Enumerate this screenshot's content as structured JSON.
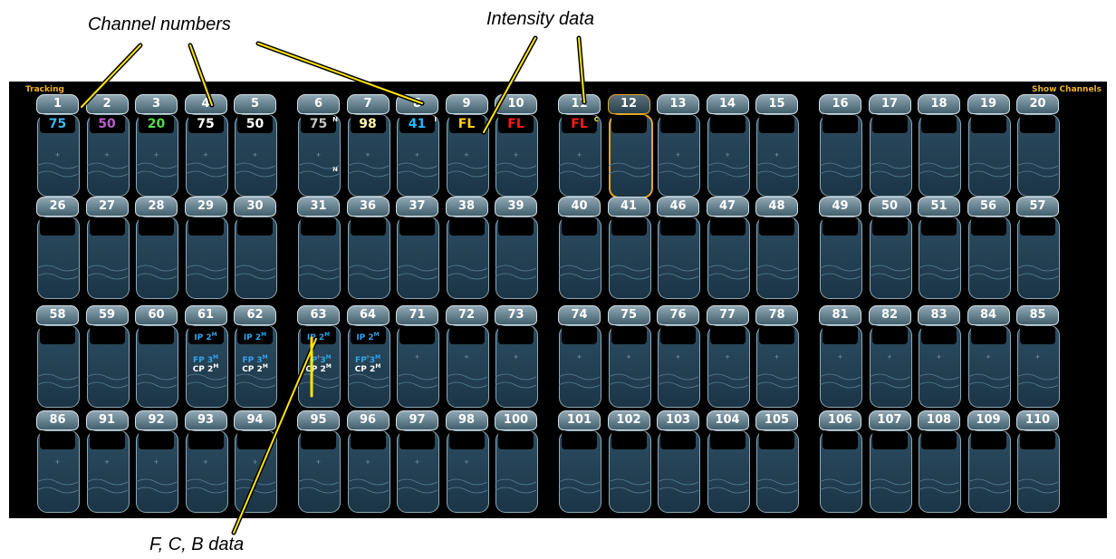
{
  "callouts": {
    "channel_numbers": "Channel numbers",
    "intensity_data": "Intensity data",
    "fcb_data": "F, C, B data"
  },
  "panel": {
    "left_label": "Tracking",
    "right_label": "Show Channels"
  },
  "channels": {
    "rows": [
      [
        {
          "n": "1",
          "int": "75",
          "icls": "c1"
        },
        {
          "n": "2",
          "int": "50",
          "icls": "c2"
        },
        {
          "n": "3",
          "int": "20",
          "icls": "c3"
        },
        {
          "n": "4",
          "int": "75",
          "icls": "c4"
        },
        {
          "n": "5",
          "int": "50",
          "icls": "c5"
        },
        {
          "n": "6",
          "int": "75",
          "icls": "c6",
          "flag": "N",
          "mark": "N"
        },
        {
          "n": "7",
          "int": "98",
          "icls": "c7"
        },
        {
          "n": "8",
          "int": "41",
          "icls": "c8",
          "flag": "I"
        },
        {
          "n": "9",
          "int": "FL",
          "icls": "c9"
        },
        {
          "n": "10",
          "int": "FL",
          "icls": "c10"
        },
        {
          "n": "11",
          "int": "FL",
          "icls": "c11",
          "flag": "C",
          "flagcls": "ycol"
        },
        {
          "n": "12",
          "sel": true
        },
        {
          "n": "13"
        },
        {
          "n": "14"
        },
        {
          "n": "15"
        },
        {
          "n": "16"
        },
        {
          "n": "17"
        },
        {
          "n": "18"
        },
        {
          "n": "19"
        },
        {
          "n": "20"
        }
      ],
      [
        {
          "n": "26"
        },
        {
          "n": "27"
        },
        {
          "n": "28"
        },
        {
          "n": "29"
        },
        {
          "n": "30"
        },
        {
          "n": "31"
        },
        {
          "n": "36"
        },
        {
          "n": "37"
        },
        {
          "n": "38"
        },
        {
          "n": "39"
        },
        {
          "n": "40"
        },
        {
          "n": "41"
        },
        {
          "n": "46"
        },
        {
          "n": "47"
        },
        {
          "n": "48"
        },
        {
          "n": "49"
        },
        {
          "n": "50"
        },
        {
          "n": "51"
        },
        {
          "n": "56"
        },
        {
          "n": "57"
        }
      ],
      [
        {
          "n": "58"
        },
        {
          "n": "59"
        },
        {
          "n": "60"
        },
        {
          "n": "61",
          "ref": true
        },
        {
          "n": "62",
          "ref": true
        },
        {
          "n": "63",
          "ref": true
        },
        {
          "n": "64",
          "ref": true
        },
        {
          "n": "71"
        },
        {
          "n": "72"
        },
        {
          "n": "73"
        },
        {
          "n": "74"
        },
        {
          "n": "75"
        },
        {
          "n": "76"
        },
        {
          "n": "77"
        },
        {
          "n": "78"
        },
        {
          "n": "81"
        },
        {
          "n": "82"
        },
        {
          "n": "83"
        },
        {
          "n": "84"
        },
        {
          "n": "85"
        }
      ],
      [
        {
          "n": "86"
        },
        {
          "n": "91"
        },
        {
          "n": "92"
        },
        {
          "n": "93"
        },
        {
          "n": "94"
        },
        {
          "n": "95"
        },
        {
          "n": "96"
        },
        {
          "n": "97"
        },
        {
          "n": "98"
        },
        {
          "n": "100"
        },
        {
          "n": "101"
        },
        {
          "n": "102"
        },
        {
          "n": "103"
        },
        {
          "n": "104"
        },
        {
          "n": "105"
        },
        {
          "n": "106"
        },
        {
          "n": "107"
        },
        {
          "n": "108"
        },
        {
          "n": "109"
        },
        {
          "n": "110"
        }
      ]
    ]
  },
  "refs": {
    "ip": "IP 2",
    "fp": "FP 3",
    "cp": "CP 2",
    "sup": "M"
  }
}
